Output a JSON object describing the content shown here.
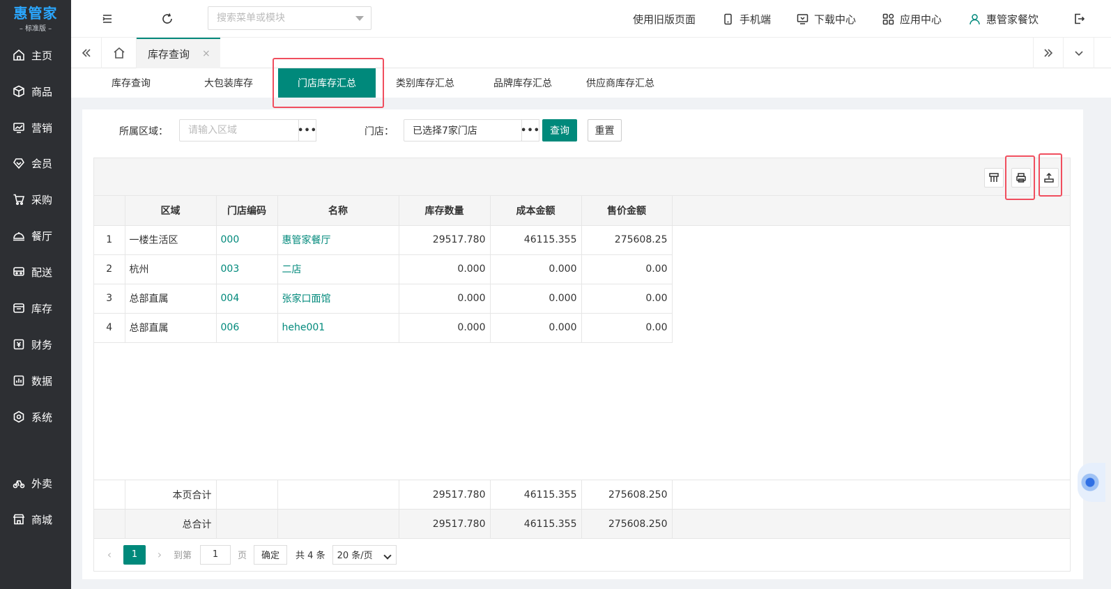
{
  "brand": {
    "name": "惠管家",
    "edition": "– 标准版 –"
  },
  "sidebar": {
    "items": [
      {
        "label": "主页",
        "icon": "home-icon"
      },
      {
        "label": "商品",
        "icon": "cube-icon"
      },
      {
        "label": "营销",
        "icon": "chart-icon"
      },
      {
        "label": "会员",
        "icon": "diamond-icon"
      },
      {
        "label": "采购",
        "icon": "cart-icon"
      },
      {
        "label": "餐厅",
        "icon": "cloche-icon"
      },
      {
        "label": "配送",
        "icon": "truck-icon"
      },
      {
        "label": "库存",
        "icon": "box-icon"
      },
      {
        "label": "财务",
        "icon": "finance-icon"
      },
      {
        "label": "数据",
        "icon": "data-icon"
      },
      {
        "label": "系统",
        "icon": "gear-icon"
      },
      {
        "label": "外卖",
        "icon": "bike-icon"
      },
      {
        "label": "商城",
        "icon": "store-icon"
      }
    ]
  },
  "header": {
    "search_placeholder": "搜索菜单或模块",
    "links": {
      "old_page": "使用旧版页面",
      "mobile": "手机端",
      "download": "下载中心",
      "apps": "应用中心",
      "user": "惠管家餐饮"
    }
  },
  "tabs": {
    "active": "库存查询",
    "close": "×"
  },
  "subnav": {
    "items": [
      "库存查询",
      "大包装库存",
      "门店库存汇总",
      "类别库存汇总",
      "品牌库存汇总",
      "供应商库存汇总"
    ],
    "active_index": 2
  },
  "filters": {
    "region_label": "所属区域：",
    "region_placeholder": "请输入区域",
    "store_label": "门店：",
    "store_value": "已选择7家门店",
    "dots": "•••",
    "query_btn": "查询",
    "reset_btn": "重置"
  },
  "table": {
    "columns": [
      "区域",
      "门店编码",
      "名称",
      "库存数量",
      "成本金额",
      "售价金额"
    ],
    "rows": [
      {
        "idx": "1",
        "region": "一楼生活区",
        "code": "000",
        "name": "惠管家餐厅",
        "qty": "29517.780",
        "cost": "46115.355",
        "price": "275608.25"
      },
      {
        "idx": "2",
        "region": "杭州",
        "code": "003",
        "name": "二店",
        "qty": "0.000",
        "cost": "0.000",
        "price": "0.00"
      },
      {
        "idx": "3",
        "region": "总部直属",
        "code": "004",
        "name": "张家口面馆",
        "qty": "0.000",
        "cost": "0.000",
        "price": "0.00"
      },
      {
        "idx": "4",
        "region": "总部直属",
        "code": "006",
        "name": "hehe001",
        "qty": "0.000",
        "cost": "0.000",
        "price": "0.00"
      }
    ],
    "totals": [
      {
        "label": "本页合计",
        "qty": "29517.780",
        "cost": "46115.355",
        "price": "275608.250"
      },
      {
        "label": "总合计",
        "qty": "29517.780",
        "cost": "46115.355",
        "price": "275608.250"
      }
    ]
  },
  "pager": {
    "current": "1",
    "goto_label": "到第",
    "goto_value": "1",
    "page_suffix": "页",
    "confirm": "确定",
    "total": "共 4 条",
    "page_size": "20 条/页"
  },
  "colors": {
    "accent": "#00897b",
    "sidebar": "#2d2f33",
    "highlight": "#f04e5e"
  }
}
